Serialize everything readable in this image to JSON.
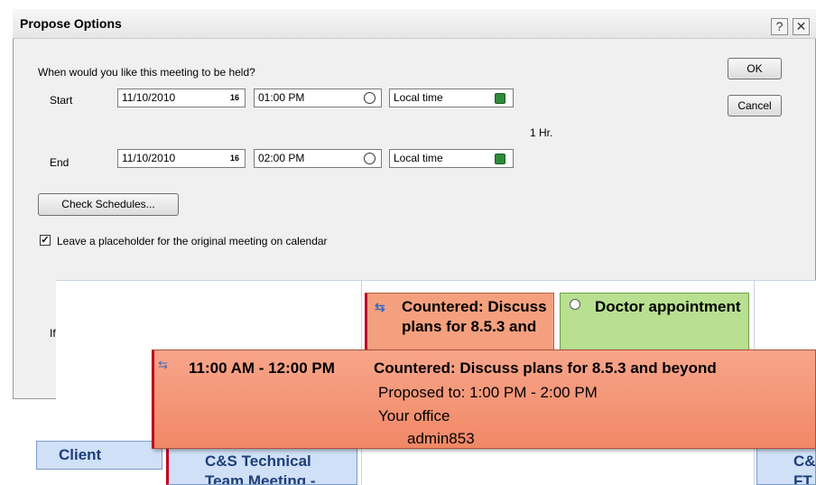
{
  "dialog": {
    "title": "Propose Options",
    "help_label": "?",
    "close_label": "✕",
    "question": "When would you like this meeting to be held?",
    "start_label": "Start",
    "start_date": "11/10/2010",
    "start_time": "01:00 PM",
    "start_zone": "Local time",
    "duration": "1 Hr.",
    "end_label": "End",
    "end_date": "11/10/2010",
    "end_time": "02:00 PM",
    "end_zone": "Local time",
    "calendar_icon_text": "16",
    "check_schedules_label": "Check Schedules...",
    "placeholder_checked": true,
    "placeholder_label": "Leave a placeholder for the original meeting on calendar",
    "ok_label": "OK",
    "cancel_label": "Cancel",
    "partial_text": "If"
  },
  "calendar": {
    "appt_countered": "Countered: Discuss plans for 8.5.3 and",
    "appt_doctor": "Doctor appointment",
    "appt_client": "Client",
    "appt_technical": "C&S Technical Team Meeting -",
    "appt_right": "C& FT"
  },
  "tooltip": {
    "time_range": "11:00 AM - 12:00 PM",
    "subject": "Countered: Discuss plans for 8.5.3 and beyond",
    "proposed": "Proposed to: 1:00 PM - 2:00 PM",
    "location": "Your office",
    "organizer": "admin853"
  },
  "colors": {
    "countered_bg": "#f4a07e",
    "doctor_bg": "#b8e090",
    "client_bg": "#cfe0f7",
    "tooltip_border": "#c0001e"
  }
}
